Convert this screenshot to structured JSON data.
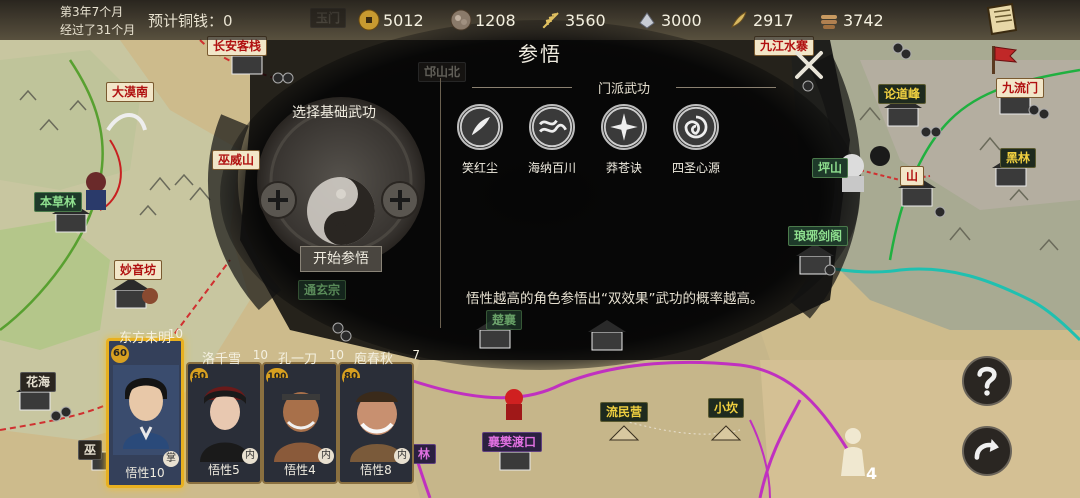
{
  "header": {
    "year_month": "第3年7个月",
    "elapsed": "经过了31个月",
    "expected_money_label": "预计铜钱：0",
    "resources": [
      {
        "icon": "copper-coin-icon",
        "value": "5012"
      },
      {
        "icon": "ore-icon",
        "value": "1208"
      },
      {
        "icon": "wheat-icon",
        "value": "3560"
      },
      {
        "icon": "iron-icon",
        "value": "3000"
      },
      {
        "icon": "herb-icon",
        "value": "2917"
      },
      {
        "icon": "wood-icon",
        "value": "3742"
      }
    ]
  },
  "map_labels": {
    "changan": "长安客栈",
    "damonan": "大漠南",
    "bencaolin": "本草林",
    "miaoyinfang": "妙音坊",
    "huahai": "花海",
    "wuweishan": "巫威山",
    "yumen": "玉门",
    "qiushanbei": "邙山北",
    "jiujiang": "九江水寨",
    "lundaofeng": "论道峰",
    "jiuliumen": "九流门",
    "pingshan": "坪山",
    "heilin": "黑林",
    "langya": "琅琊剑阁",
    "chuxiang": "楚襄",
    "liuminying": "流民营",
    "xiaokan": "小坎",
    "xiangfan": "襄樊渡口",
    "lin": "林",
    "shan": "山",
    "tongxuan": "通玄宗",
    "wu": "巫"
  },
  "dialog": {
    "title": "参悟",
    "base_title": "选择基础武功",
    "start_button": "开始参悟",
    "school_title": "门派武功",
    "skills": [
      {
        "name": "笑红尘",
        "icon": "feather-hand-skill-icon"
      },
      {
        "name": "海纳百川",
        "icon": "wave-skill-icon"
      },
      {
        "name": "莽苍诀",
        "icon": "burst-skill-icon"
      },
      {
        "name": "四圣心源",
        "icon": "vortex-skill-icon"
      }
    ],
    "hint": "悟性越高的角色参悟出“双效果”武功的概率越高。"
  },
  "characters": [
    {
      "name": "东方未明",
      "level": "10",
      "badge": "60",
      "stat": "悟性10",
      "tag": "掌",
      "selected": true
    },
    {
      "name": "洛千雪",
      "level": "10",
      "badge": "60",
      "stat": "悟性5",
      "tag": "内",
      "selected": false
    },
    {
      "name": "孔一刀",
      "level": "10",
      "badge": "100",
      "stat": "悟性4",
      "tag": "内",
      "selected": false
    },
    {
      "name": "庖春秋",
      "level": "7",
      "badge": "80",
      "stat": "悟性8",
      "tag": "内",
      "selected": false
    }
  ],
  "follower_count": "4",
  "colors": {
    "selected_border": "#e8b020",
    "card_border": "#8a7040",
    "accent_red": "#b01010"
  }
}
